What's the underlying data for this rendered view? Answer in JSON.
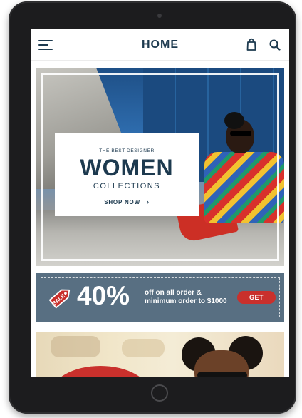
{
  "header": {
    "title": "HOME",
    "menu_icon": "hamburger-menu-icon",
    "bag_icon": "shopping-bag-icon",
    "search_icon": "search-icon"
  },
  "hero": {
    "eyebrow": "THE BEST DESIGNER",
    "title": "WOMEN",
    "subtitle": "COLLECTIONS",
    "cta_label": "SHOP NOW",
    "cta_icon": "chevron-right-icon"
  },
  "promo": {
    "tag_label": "SALE",
    "tag_icon": "price-tag-icon",
    "percent": "40%",
    "text_line1": "off on all order &",
    "text_line2": "minimum order to $1000",
    "button_label": "GET"
  },
  "colors": {
    "brand_navy": "#1d3a4f",
    "promo_slate": "#586f82",
    "accent_red": "#c9302c",
    "device_frame": "#1c1c1e"
  }
}
